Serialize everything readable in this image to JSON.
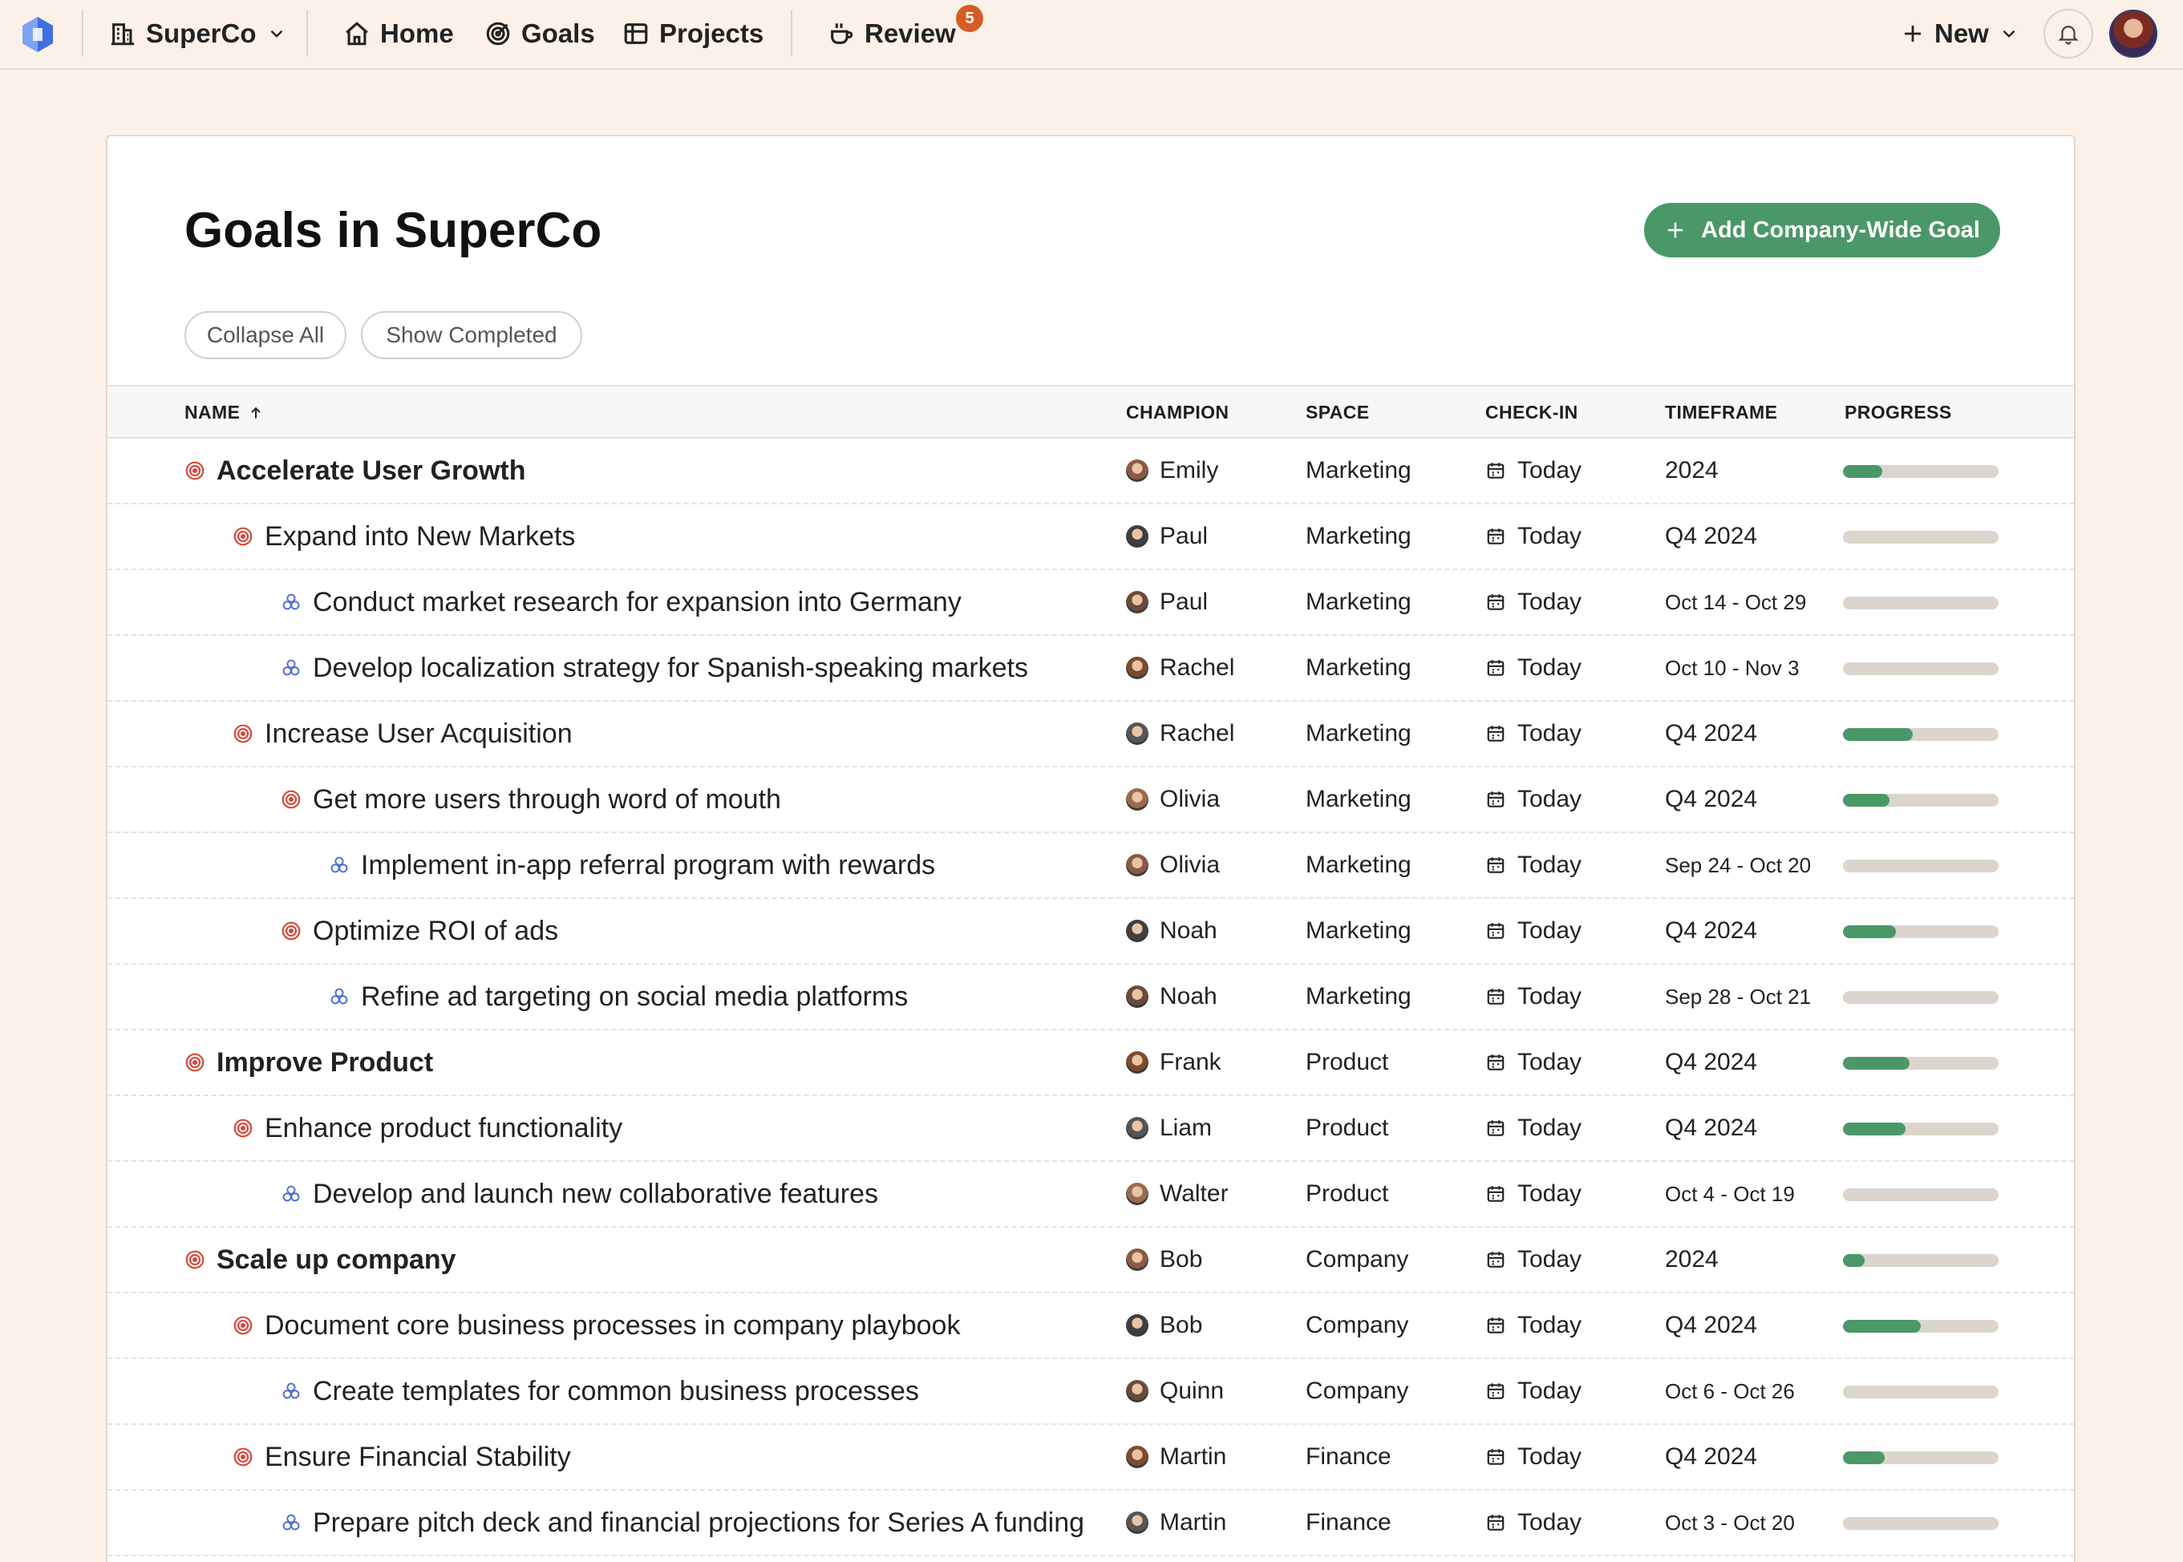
{
  "topbar": {
    "company": "SuperCo",
    "nav": [
      "Home",
      "Goals",
      "Projects"
    ],
    "review_label": "Review",
    "review_count": "5",
    "new_label": "New"
  },
  "page": {
    "title": "Goals in SuperCo",
    "add_button": "Add Company-Wide Goal",
    "collapse_all": "Collapse All",
    "show_completed": "Show Completed"
  },
  "columns": {
    "name": "NAME",
    "champion": "CHAMPION",
    "space": "SPACE",
    "checkin": "CHECK-IN",
    "timeframe": "TIMEFRAME",
    "progress": "PROGRESS"
  },
  "colors": {
    "accent": "#4a9768",
    "goal_icon": "#d9473a",
    "project_icon": "#4f6fd0",
    "badge": "#d65c26"
  },
  "rows": [
    {
      "type": "goal",
      "level": 0,
      "name": "Accelerate User Growth",
      "champion": "Emily",
      "space": "Marketing",
      "checkin": "Today",
      "timeframe": "2024",
      "progress": 0.25
    },
    {
      "type": "goal",
      "level": 1,
      "name": "Expand into New Markets",
      "champion": "Paul",
      "space": "Marketing",
      "checkin": "Today",
      "timeframe": "Q4 2024",
      "progress": 0
    },
    {
      "type": "project",
      "level": 2,
      "name": "Conduct market research for expansion into Germany",
      "champion": "Paul",
      "space": "Marketing",
      "checkin": "Today",
      "timeframe": "Oct 14 - Oct 29",
      "progress": 0
    },
    {
      "type": "project",
      "level": 2,
      "name": "Develop localization strategy for Spanish-speaking markets",
      "champion": "Rachel",
      "space": "Marketing",
      "checkin": "Today",
      "timeframe": "Oct 10 - Nov 3",
      "progress": 0
    },
    {
      "type": "goal",
      "level": 1,
      "name": "Increase User Acquisition",
      "champion": "Rachel",
      "space": "Marketing",
      "checkin": "Today",
      "timeframe": "Q4 2024",
      "progress": 0.45
    },
    {
      "type": "goal",
      "level": 2,
      "name": "Get more users through word of mouth",
      "champion": "Olivia",
      "space": "Marketing",
      "checkin": "Today",
      "timeframe": "Q4 2024",
      "progress": 0.3
    },
    {
      "type": "project",
      "level": 3,
      "name": "Implement in-app referral program with rewards",
      "champion": "Olivia",
      "space": "Marketing",
      "checkin": "Today",
      "timeframe": "Sep 24 - Oct 20",
      "progress": 0
    },
    {
      "type": "goal",
      "level": 2,
      "name": "Optimize ROI of ads",
      "champion": "Noah",
      "space": "Marketing",
      "checkin": "Today",
      "timeframe": "Q4 2024",
      "progress": 0.34
    },
    {
      "type": "project",
      "level": 3,
      "name": "Refine ad targeting on social media platforms",
      "champion": "Noah",
      "space": "Marketing",
      "checkin": "Today",
      "timeframe": "Sep 28 - Oct 21",
      "progress": 0
    },
    {
      "type": "goal",
      "level": 0,
      "name": "Improve Product",
      "champion": "Frank",
      "space": "Product",
      "checkin": "Today",
      "timeframe": "Q4 2024",
      "progress": 0.43
    },
    {
      "type": "goal",
      "level": 1,
      "name": "Enhance product functionality",
      "champion": "Liam",
      "space": "Product",
      "checkin": "Today",
      "timeframe": "Q4 2024",
      "progress": 0.4
    },
    {
      "type": "project",
      "level": 2,
      "name": "Develop and launch new collaborative features",
      "champion": "Walter",
      "space": "Product",
      "checkin": "Today",
      "timeframe": "Oct 4 - Oct 19",
      "progress": 0
    },
    {
      "type": "goal",
      "level": 0,
      "name": "Scale up company",
      "champion": "Bob",
      "space": "Company",
      "checkin": "Today",
      "timeframe": "2024",
      "progress": 0.14
    },
    {
      "type": "goal",
      "level": 1,
      "name": "Document core business processes in company playbook",
      "champion": "Bob",
      "space": "Company",
      "checkin": "Today",
      "timeframe": "Q4 2024",
      "progress": 0.5
    },
    {
      "type": "project",
      "level": 2,
      "name": "Create templates for common business processes",
      "champion": "Quinn",
      "space": "Company",
      "checkin": "Today",
      "timeframe": "Oct 6 - Oct 26",
      "progress": 0
    },
    {
      "type": "goal",
      "level": 1,
      "name": "Ensure Financial Stability",
      "champion": "Martin",
      "space": "Finance",
      "checkin": "Today",
      "timeframe": "Q4 2024",
      "progress": 0.27
    },
    {
      "type": "project",
      "level": 2,
      "name": "Prepare pitch deck and financial projections for Series A funding",
      "champion": "Martin",
      "space": "Finance",
      "checkin": "Today",
      "timeframe": "Oct 3 - Oct 20",
      "progress": 0
    }
  ]
}
